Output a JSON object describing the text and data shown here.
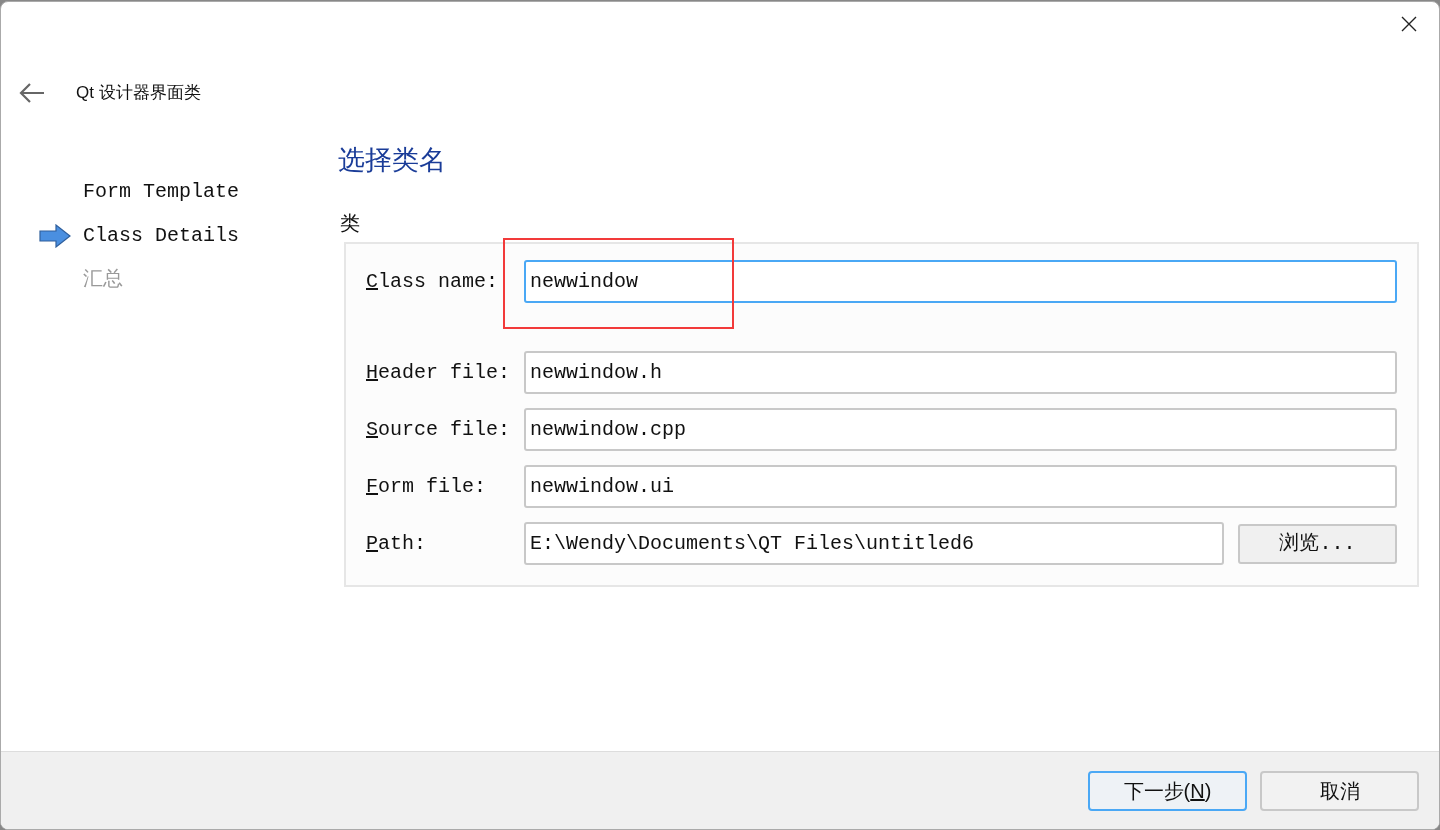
{
  "header": {
    "title": "Qt 设计器界面类"
  },
  "steps": [
    {
      "label": "Form Template",
      "selected": false,
      "disabled": false
    },
    {
      "label": "Class Details",
      "selected": true,
      "disabled": false
    },
    {
      "label": "汇总",
      "selected": false,
      "disabled": true
    }
  ],
  "page_title": "选择类名",
  "group": {
    "title": "类",
    "fields": [
      {
        "accel": "C",
        "label": "lass name:",
        "value": "newwindow",
        "focused": true
      },
      {
        "accel": "H",
        "label": "eader file:",
        "value": "newwindow.h",
        "focused": false
      },
      {
        "accel": "S",
        "label": "ource file:",
        "value": "newwindow.cpp",
        "focused": false
      },
      {
        "accel": "F",
        "label": "orm file:",
        "value": "newwindow.ui",
        "focused": false
      },
      {
        "accel": "P",
        "label": "ath:",
        "value": "E:\\Wendy\\Documents\\QT Files\\untitled6",
        "focused": false,
        "button": "浏览..."
      }
    ]
  },
  "buttons": [
    {
      "before": "下一步(",
      "accel": "N",
      "after": ")",
      "default": true
    },
    {
      "before": "取消",
      "default": false
    }
  ]
}
